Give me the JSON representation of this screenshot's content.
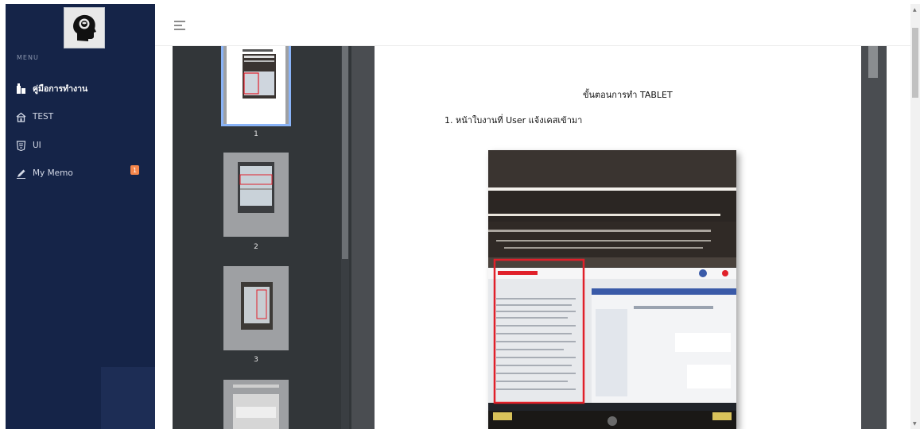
{
  "sidebar": {
    "menu_caption": "MENU",
    "items": [
      {
        "label": "คู่มือการทำงาน",
        "icon": "building-icon",
        "active": true
      },
      {
        "label": "TEST",
        "icon": "house-icon",
        "active": false
      },
      {
        "label": "UI",
        "icon": "html5-icon",
        "active": false
      },
      {
        "label": "My Memo",
        "icon": "pencil-icon",
        "active": false,
        "badge": "1"
      }
    ]
  },
  "header": {
    "menu_icon": "hamburger-icon"
  },
  "pdf": {
    "thumbnails": [
      {
        "number": "1",
        "selected": true
      },
      {
        "number": "2",
        "selected": false
      },
      {
        "number": "3",
        "selected": false
      }
    ],
    "page": {
      "title": "ขั้นตอนการทำ TABLET",
      "step_1": "1.  หน้าใบงานที่ User แจ้งเคสเข้ามา"
    }
  },
  "colors": {
    "sidebar_bg": "#152448",
    "badge": "#f5864b",
    "thumb_selected": "#8ab4f8",
    "highlight_box": "#e0202a"
  }
}
